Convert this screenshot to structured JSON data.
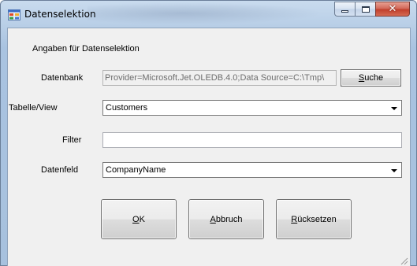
{
  "window": {
    "title": "Datenselektion",
    "icon": "window-app-icon",
    "controls": [
      "minimize-icon",
      "maximize-icon",
      "close-icon"
    ],
    "close_glyph": "✕"
  },
  "form": {
    "group_label": "Angaben für Datenselektion",
    "datenbank": {
      "label": "Datenbank",
      "value": "Provider=Microsoft.Jet.OLEDB.4.0;Data Source=C:\\Tmp\\",
      "search_button": {
        "accel": "S",
        "rest": "uche"
      }
    },
    "tabelle": {
      "label": "Tabelle/View",
      "selected": "Customers"
    },
    "filter": {
      "label": "Filter",
      "value": ""
    },
    "datenfeld": {
      "label": "Datenfeld",
      "selected": "CompanyName"
    }
  },
  "buttons": {
    "ok": {
      "accel": "O",
      "rest": "K"
    },
    "abbruch": {
      "accel": "A",
      "rest": "bbruch"
    },
    "reset": {
      "accel": "R",
      "rest": "ücksetzen"
    }
  },
  "colors": {
    "titlebar": "#b9cfe7",
    "close_button": "#c1402c",
    "client_bg": "#f0f0f0"
  }
}
